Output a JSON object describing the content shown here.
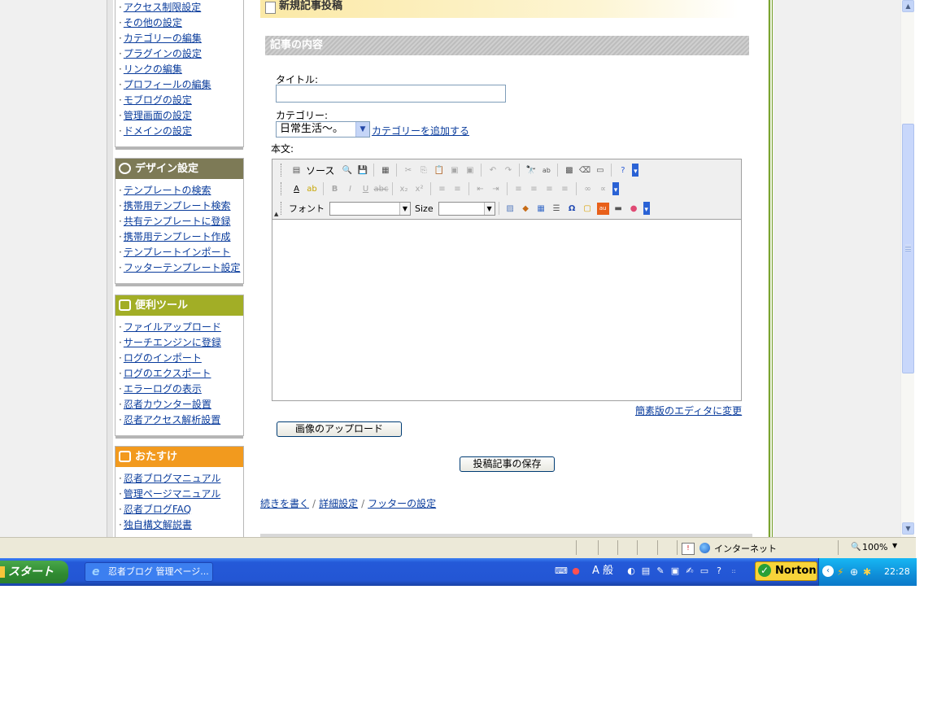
{
  "sidebar": {
    "admin_items": [
      "アクセス制限設定",
      "その他の設定",
      "カテゴリーの編集",
      "プラグインの設定",
      "リンクの編集",
      "プロフィールの編集",
      "モブログの設定",
      "管理画面の設定",
      "ドメインの設定"
    ],
    "design": {
      "title": "デザイン設定",
      "items": [
        "テンプレートの検索",
        "携帯用テンプレート検索",
        "共有テンプレートに登録",
        "携帯用テンプレート作成",
        "テンプレートインポート",
        "フッターテンプレート設定"
      ]
    },
    "tools": {
      "title": "便利ツール",
      "items": [
        "ファイルアップロード",
        "サーチエンジンに登録",
        "ログのインポート",
        "ログのエクスポート",
        "エラーログの表示",
        "忍者カウンター設置",
        "忍者アクセス解析設置"
      ]
    },
    "recommend": {
      "title": "おたすけ",
      "items": [
        "忍者ブログマニュアル",
        "管理ページマニュアル",
        "忍者ブログFAQ",
        "独自構文解説書"
      ]
    },
    "colors": {
      "design_head": "#7d7a56",
      "tools_head": "#a2ae26",
      "recommend_head": "#f29a1e"
    }
  },
  "main": {
    "page_title": "新規記事投稿",
    "section_title": "記事の内容",
    "title_label": "タイトル:",
    "title_value": "",
    "category_label": "カテゴリー:",
    "category_value": "日常生活〜。",
    "add_category": "カテゴリーを追加する",
    "body_label": "本文:",
    "simple_editor_link": "簡素版のエディタに変更",
    "upload_button": "画像のアップロード",
    "save_button": "投稿記事の保存",
    "links": {
      "continue": "続きを書く",
      "detail": "詳細設定",
      "footer": "フッターの設定",
      "separator": "/"
    }
  },
  "editor": {
    "source_label": "ソース",
    "font_label": "フォント",
    "size_label": "Size",
    "font_value": "",
    "size_value": ""
  },
  "status": {
    "zone": "インターネット",
    "zoom": "100%"
  },
  "taskbar": {
    "start": "スタート",
    "window": "忍者ブログ 管理ページ...",
    "ime": "A 般",
    "norton": "Norton",
    "clock": "22:28"
  }
}
